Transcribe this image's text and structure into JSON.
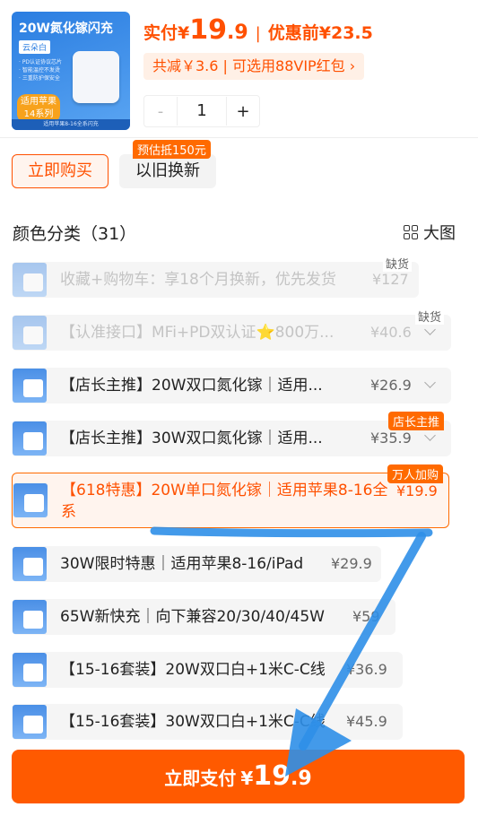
{
  "product": {
    "thumb_title": "20W氮化镓闪充",
    "thumb_variant": "云朵白",
    "thumb_bullets": [
      "· PD认证协议芯片",
      "· 智能温控不发烫",
      "· 三重防护保安全"
    ],
    "thumb_badge": "适用苹果14系列",
    "thumb_footer": "适用苹果8-16全系闪充"
  },
  "pricing": {
    "paid_label": "实付",
    "currency": "¥",
    "paid_int": "19",
    "paid_dec": ".9",
    "separator": "|",
    "before_label": "优惠前",
    "before_value": "¥23.5",
    "promo_text": "共减￥3.6 | 可选用88VIP红包 ›"
  },
  "quantity": {
    "minus": "-",
    "value": "1",
    "plus": "+"
  },
  "purchase": {
    "buy_now": "立即购买",
    "trade_in": "以旧换新",
    "trade_in_badge": "预估抵150元"
  },
  "section": {
    "title": "颜色分类（31）",
    "big_view": "大图"
  },
  "options": [
    {
      "label": "收藏+购物车：享18个月换新，优先发货",
      "price": "¥127",
      "tag": "缺货",
      "tag_type": "gray",
      "state": "disabled"
    },
    {
      "label": "【认准接口】MFi+PD双认证⭐800万...",
      "price": "¥40.6",
      "tag": "缺货",
      "tag_type": "gray",
      "state": "disabled"
    },
    {
      "label": "【店长主推】20W双口氮化镓｜适用...",
      "price": "¥26.9",
      "tag": "",
      "tag_type": "",
      "state": "normal"
    },
    {
      "label": "【店长主推】30W双口氮化镓｜适用...",
      "price": "¥35.9",
      "tag": "店长主推",
      "tag_type": "orange",
      "state": "normal"
    },
    {
      "label": "【618特惠】20W单口氮化镓｜适用苹果8-16全系",
      "price": "¥19.9",
      "tag": "万人加购",
      "tag_type": "orange",
      "state": "selected"
    },
    {
      "label": "30W限时特惠｜适用苹果8-16/iPad",
      "price": "¥29.9",
      "tag": "",
      "tag_type": "",
      "state": "normal"
    },
    {
      "label": "65W新快充｜向下兼容20/30/40/45W",
      "price": "¥59",
      "tag": "",
      "tag_type": "",
      "state": "normal"
    },
    {
      "label": "【15-16套装】20W双口白+1米C-C线",
      "price": "¥36.9",
      "tag": "",
      "tag_type": "",
      "state": "normal"
    },
    {
      "label": "【15-16套装】30W双口白+1米C-C线",
      "price": "¥45.9",
      "tag": "",
      "tag_type": "",
      "state": "normal"
    }
  ],
  "pay": {
    "label": "立即支付",
    "currency": "¥",
    "int": "19",
    "dec": ".9"
  },
  "colors": {
    "accent": "#ff5000",
    "annotation": "#2f8fe8"
  }
}
